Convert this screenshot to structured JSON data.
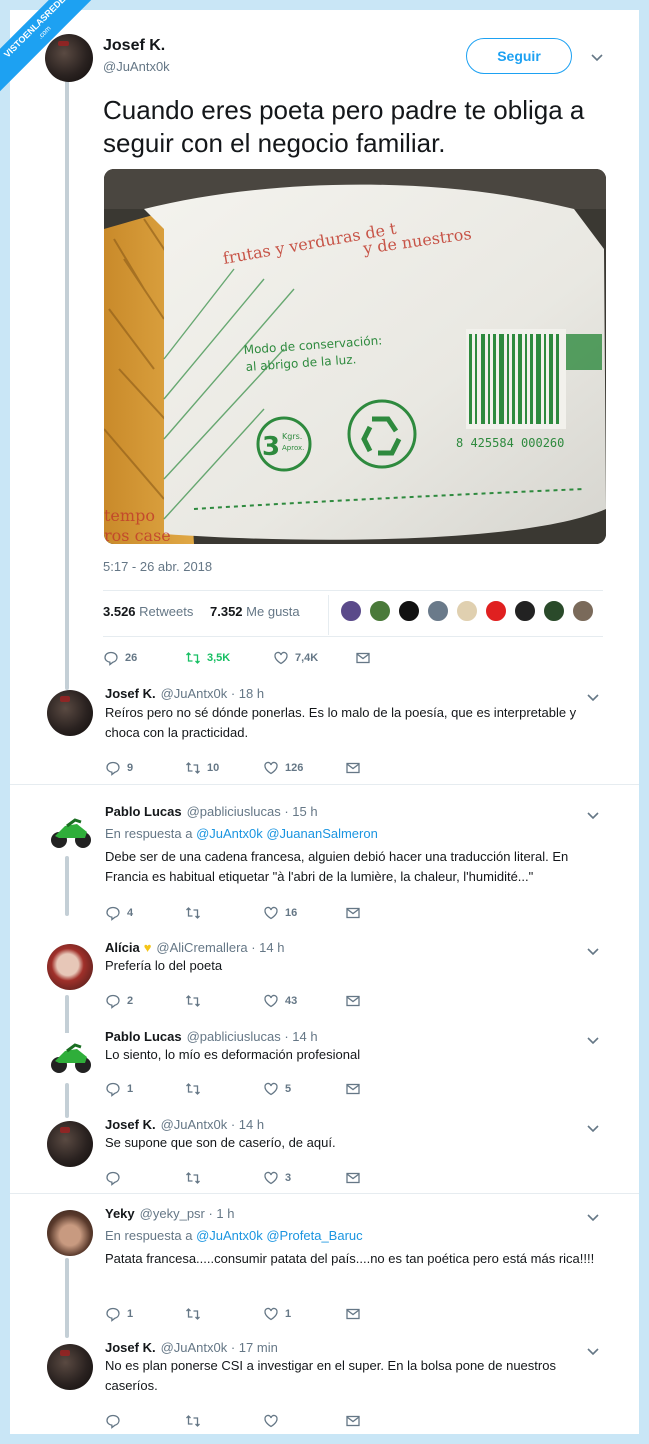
{
  "watermark": {
    "line1": "VISTOENLASREDES",
    "line2": ".com"
  },
  "main_tweet": {
    "author_name": "Josef K.",
    "author_handle": "@JuAntx0k",
    "follow_label": "Seguir",
    "text": "Cuando eres poeta pero padre te obliga a seguir con el negocio familiar.",
    "photo": {
      "bag_text_top1": "frutas y verduras de t",
      "bag_text_top2": "y de nuestros",
      "bag_text_mid1": "Modo de conservación:",
      "bag_text_mid2": "al abrigo de la luz.",
      "weight_number": "3",
      "weight_unit1": "Kgrs.",
      "weight_unit2": "Aprox.",
      "barcode_number": "8 425584 000260",
      "bag_text_bottom1": "tempo",
      "bag_text_bottom2": "ros case"
    },
    "timestamp": "5:17 - 26 abr. 2018",
    "retweets_count": "3.526",
    "retweets_label": "Retweets",
    "likes_count": "7.352",
    "likes_label": "Me gusta",
    "likers": [
      "#5a4a8a",
      "#4a7a3a",
      "#111111",
      "#6a7a8a",
      "#e0d0b0",
      "#e02020",
      "#222222",
      "#2a4a2a",
      "#7a6a5a"
    ],
    "actions": {
      "replies": "26",
      "retweets": "3,5K",
      "likes": "7,4K"
    }
  },
  "replies": [
    {
      "name": "Josef K.",
      "meta": "@JuAntx0k · 18 h",
      "text": "Reíros pero no sé dónde ponerlas. Es lo malo de la poesía, que es interpretable y choca con la practicidad.",
      "replies": "9",
      "retweets": "10",
      "likes": "126"
    },
    {
      "name": "Pablo Lucas",
      "meta": "@pabliciuslucas · 15 h",
      "reply_prefix": "En respuesta a",
      "reply_users": "@JuAntx0k @JuananSalmeron",
      "text": "Debe ser de una cadena francesa, alguien debió hacer una traducción literal. En Francia es habitual etiquetar \"à l'abri de la lumière, la chaleur, l'humidité...\"",
      "replies": "4",
      "retweets": "",
      "likes": "16"
    },
    {
      "name": "Alícia",
      "meta": "@AliCremallera · 14 h",
      "text": "Prefería lo del poeta",
      "replies": "2",
      "retweets": "",
      "likes": "43"
    },
    {
      "name": "Pablo Lucas",
      "meta": "@pabliciuslucas · 14 h",
      "text": "Lo siento, lo mío es deformación profesional",
      "replies": "1",
      "retweets": "",
      "likes": "5"
    },
    {
      "name": "Josef K.",
      "meta": "@JuAntx0k · 14 h",
      "text": "Se supone que son de caserío, de aquí.",
      "replies": "",
      "retweets": "",
      "likes": "3"
    },
    {
      "name": "Yeky",
      "meta": "@yeky_psr · 1 h",
      "reply_prefix": "En respuesta a",
      "reply_users": "@JuAntx0k @Profeta_Baruc",
      "text": "Patata francesa.....consumir patata del país....no es tan poética pero está más rica!!!!",
      "replies": "1",
      "retweets": "",
      "likes": "1"
    },
    {
      "name": "Josef K.",
      "meta": "@JuAntx0k · 17 min",
      "text": "No es plan ponerse CSI a investigar en el super. En la bolsa pone de nuestros caseríos.",
      "replies": "",
      "retweets": "",
      "likes": ""
    }
  ],
  "colors": {
    "accent": "#1da1f2",
    "retweet_green": "#17bf63",
    "muted": "#657786",
    "page_bg": "#c9e6f6"
  }
}
